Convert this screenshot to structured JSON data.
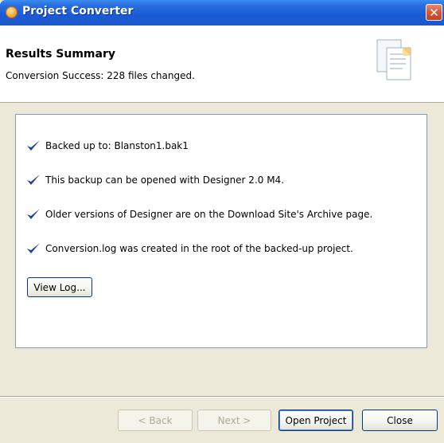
{
  "window": {
    "title": "Project Converter",
    "close_symbol": "✕"
  },
  "header": {
    "title": "Results Summary",
    "description": "Conversion Success: 228 files changed.",
    "icon": "documents-icon"
  },
  "results": {
    "items": [
      {
        "text": "Backed up to:  Blanston1.bak1",
        "icon": "checkmark-icon"
      },
      {
        "text": "This backup can be opened with Designer 2.0 M4.",
        "icon": "checkmark-icon"
      },
      {
        "text": "Older versions of Designer are on the Download Site's Archive page.",
        "icon": "checkmark-icon"
      },
      {
        "text": "Conversion.log was created in the root of the backed-up project.",
        "icon": "checkmark-icon"
      }
    ],
    "view_log_label": "View Log..."
  },
  "footer": {
    "back_label": "< Back",
    "next_label": "Next >",
    "open_project_label": "Open Project",
    "close_label": "Close"
  },
  "colors": {
    "titlebar": "#1c58c9",
    "dialog_bg": "#ece9d8",
    "check": "#1f3f9a"
  }
}
